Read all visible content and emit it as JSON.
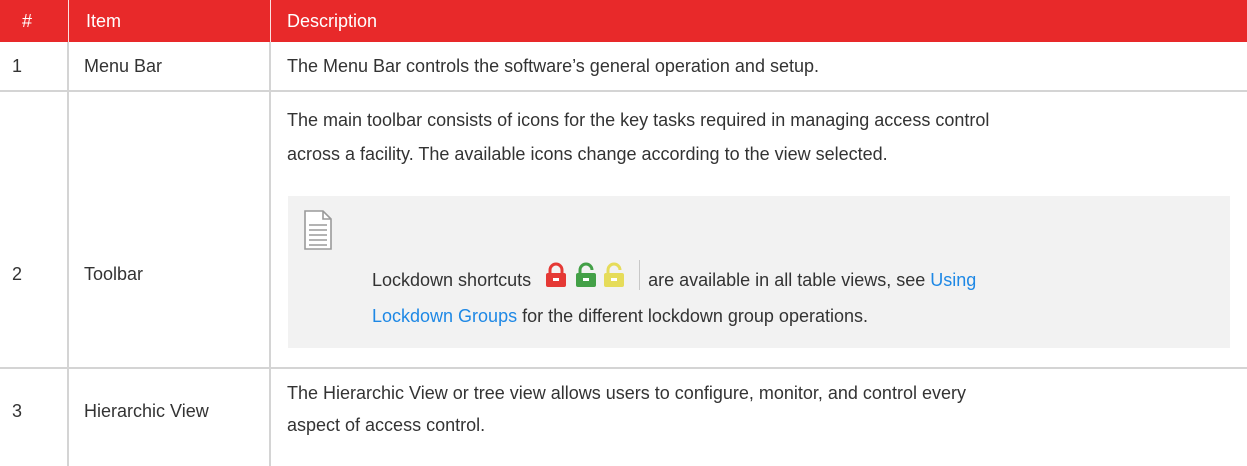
{
  "header": {
    "num": "#",
    "item": "Item",
    "description": "Description"
  },
  "rows": [
    {
      "num": "1",
      "item": "Menu Bar",
      "description": "The Menu Bar controls the software’s general operation and setup."
    },
    {
      "num": "2",
      "item": "Toolbar",
      "description_line1": "The main toolbar consists of icons for the key tasks required in managing access control",
      "description_line2": "across a facility. The available icons change according to the view selected.",
      "note": {
        "icon": "document-icon",
        "text_before": "Lockdown shortcuts",
        "text_middle": "are available in all table views, see",
        "link_part1": "Using",
        "link_part2": "Lockdown Groups",
        "text_after": "for the different lockdown group operations.",
        "shortcut_icons": [
          "lock-red-icon",
          "unlock-green-icon",
          "unlock-yellow-icon"
        ]
      }
    },
    {
      "num": "3",
      "item": "Hierarchic View",
      "description_line1": "The Hierarchic View or tree view allows users to configure, monitor, and control every",
      "description_line2": "aspect of access control."
    }
  ],
  "colors": {
    "header_bg": "#e8292a",
    "link": "#1e88e5",
    "note_bg": "#f2f2f2",
    "lock_red": "#e53935",
    "lock_green": "#43a047",
    "lock_yellow": "#e6dc5a"
  }
}
